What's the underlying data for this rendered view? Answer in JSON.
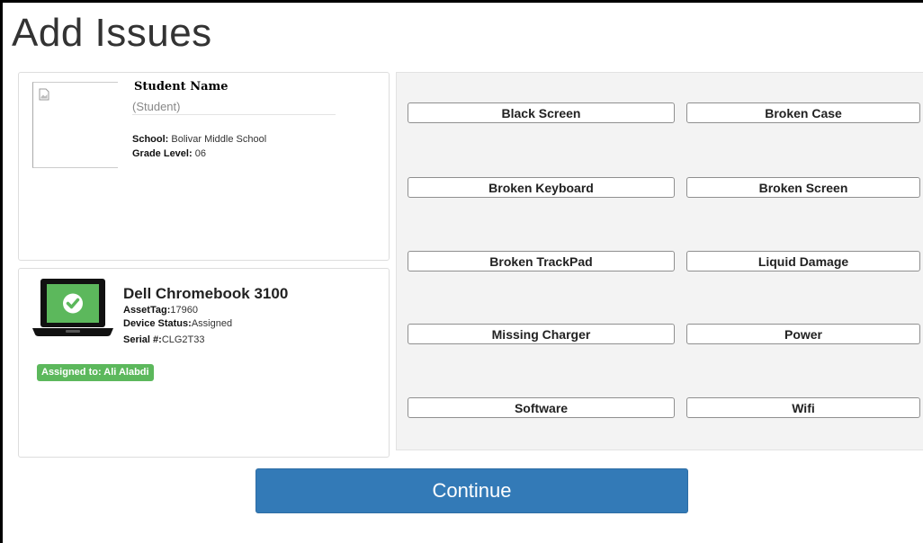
{
  "page": {
    "title": "Add Issues"
  },
  "student": {
    "name_label": "Student Name",
    "name_value": "(Student)",
    "school_label": "School:",
    "school_value": " Bolivar Middle School",
    "grade_label": "Grade Level:",
    "grade_value": " 06",
    "photo_icon": "broken-image-icon"
  },
  "device": {
    "name": "Dell Chromebook 3100",
    "asset_label": "AssetTag:",
    "asset_value": "17960",
    "status_label": "Device Status:",
    "status_value": "Assigned",
    "serial_label": "Serial #:",
    "serial_value": "CLG2T33",
    "assigned_badge": "Assigned to: Ali Alabdi",
    "icon": "laptop-check-icon",
    "status_color": "#5cb85c"
  },
  "issues": [
    "Black Screen",
    "Broken Case",
    "Broken Keyboard",
    "Broken Screen",
    "Broken TrackPad",
    "Liquid Damage",
    "Missing Charger",
    "Power",
    "Software",
    "Wifi"
  ],
  "actions": {
    "continue_label": "Continue"
  },
  "colors": {
    "primary": "#337ab7",
    "success": "#5cb85c",
    "panel_bg": "#f3f3f3"
  }
}
